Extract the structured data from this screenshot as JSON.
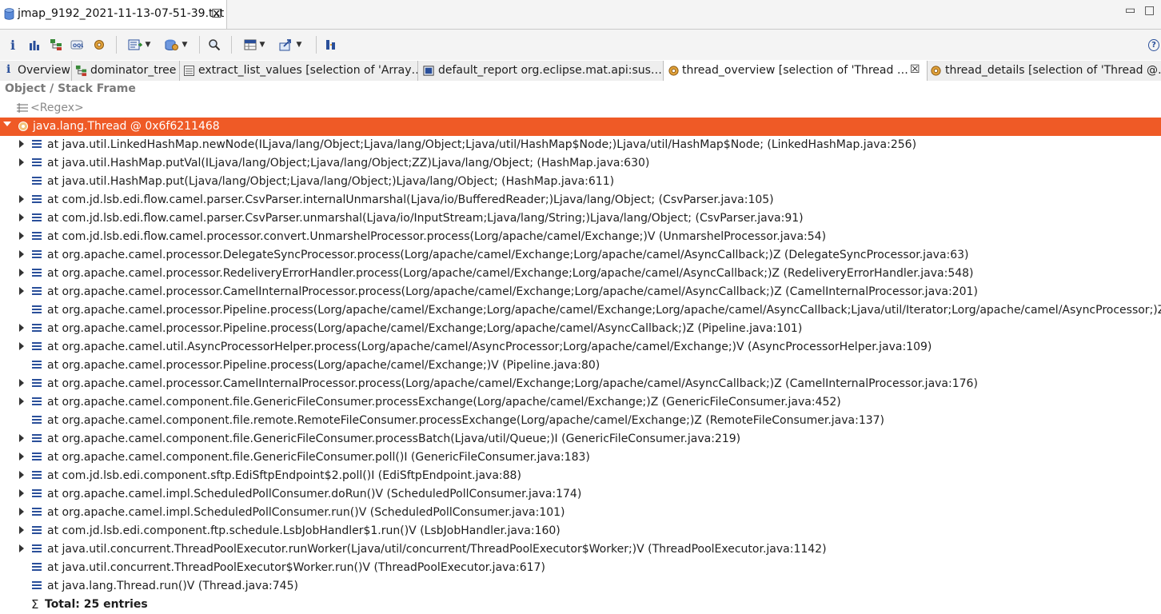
{
  "editor_tab": {
    "title": "jmap_9192_2021-11-13-07-51-39.txt",
    "close": "☒"
  },
  "window": {
    "minimize": "▭",
    "maximize": "□"
  },
  "toolbar": {
    "info": "i",
    "help": "?"
  },
  "query_tabs": [
    {
      "label": "Overview",
      "icon": "info-icon"
    },
    {
      "label": "dominator_tree",
      "icon": "tree-icon"
    },
    {
      "label": "extract_list_values  [selection of 'Array…",
      "icon": "table-icon"
    },
    {
      "label": "default_report  org.eclipse.mat.api:sus…",
      "icon": "report-icon"
    },
    {
      "label": "thread_overview  [selection of 'Thread …",
      "icon": "gear-icon",
      "active": true
    },
    {
      "label": "thread_details  [selection of 'Thread @…",
      "icon": "gear-icon"
    }
  ],
  "column_header": "Object / Stack Frame",
  "regex_placeholder": "<Regex>",
  "thread_row": "java.lang.Thread @ 0x6f6211468",
  "frames": [
    {
      "text": "at java.util.LinkedHashMap.newNode(ILjava/lang/Object;Ljava/lang/Object;Ljava/util/HashMap$Node;)Ljava/util/HashMap$Node; (LinkedHashMap.java:256)",
      "expandable": true
    },
    {
      "text": "at java.util.HashMap.putVal(ILjava/lang/Object;Ljava/lang/Object;ZZ)Ljava/lang/Object; (HashMap.java:630)",
      "expandable": true
    },
    {
      "text": "at java.util.HashMap.put(Ljava/lang/Object;Ljava/lang/Object;)Ljava/lang/Object; (HashMap.java:611)",
      "expandable": false
    },
    {
      "text": "at com.jd.lsb.edi.flow.camel.parser.CsvParser.internalUnmarshal(Ljava/io/BufferedReader;)Ljava/lang/Object; (CsvParser.java:105)",
      "expandable": true
    },
    {
      "text": "at com.jd.lsb.edi.flow.camel.parser.CsvParser.unmarshal(Ljava/io/InputStream;Ljava/lang/String;)Ljava/lang/Object; (CsvParser.java:91)",
      "expandable": true
    },
    {
      "text": "at com.jd.lsb.edi.flow.camel.processor.convert.UnmarshelProcessor.process(Lorg/apache/camel/Exchange;)V (UnmarshelProcessor.java:54)",
      "expandable": true
    },
    {
      "text": "at org.apache.camel.processor.DelegateSyncProcessor.process(Lorg/apache/camel/Exchange;Lorg/apache/camel/AsyncCallback;)Z (DelegateSyncProcessor.java:63)",
      "expandable": true
    },
    {
      "text": "at org.apache.camel.processor.RedeliveryErrorHandler.process(Lorg/apache/camel/Exchange;Lorg/apache/camel/AsyncCallback;)Z (RedeliveryErrorHandler.java:548)",
      "expandable": true
    },
    {
      "text": "at org.apache.camel.processor.CamelInternalProcessor.process(Lorg/apache/camel/Exchange;Lorg/apache/camel/AsyncCallback;)Z (CamelInternalProcessor.java:201)",
      "expandable": true
    },
    {
      "text": "at org.apache.camel.processor.Pipeline.process(Lorg/apache/camel/Exchange;Lorg/apache/camel/Exchange;Lorg/apache/camel/AsyncCallback;Ljava/util/Iterator;Lorg/apache/camel/AsyncProcessor;)Z (Pipel",
      "expandable": false
    },
    {
      "text": "at org.apache.camel.processor.Pipeline.process(Lorg/apache/camel/Exchange;Lorg/apache/camel/AsyncCallback;)Z (Pipeline.java:101)",
      "expandable": true
    },
    {
      "text": "at org.apache.camel.util.AsyncProcessorHelper.process(Lorg/apache/camel/AsyncProcessor;Lorg/apache/camel/Exchange;)V (AsyncProcessorHelper.java:109)",
      "expandable": true
    },
    {
      "text": "at org.apache.camel.processor.Pipeline.process(Lorg/apache/camel/Exchange;)V (Pipeline.java:80)",
      "expandable": false
    },
    {
      "text": "at org.apache.camel.processor.CamelInternalProcessor.process(Lorg/apache/camel/Exchange;Lorg/apache/camel/AsyncCallback;)Z (CamelInternalProcessor.java:176)",
      "expandable": true
    },
    {
      "text": "at org.apache.camel.component.file.GenericFileConsumer.processExchange(Lorg/apache/camel/Exchange;)Z (GenericFileConsumer.java:452)",
      "expandable": true
    },
    {
      "text": "at org.apache.camel.component.file.remote.RemoteFileConsumer.processExchange(Lorg/apache/camel/Exchange;)Z (RemoteFileConsumer.java:137)",
      "expandable": false
    },
    {
      "text": "at org.apache.camel.component.file.GenericFileConsumer.processBatch(Ljava/util/Queue;)I (GenericFileConsumer.java:219)",
      "expandable": true
    },
    {
      "text": "at org.apache.camel.component.file.GenericFileConsumer.poll()I (GenericFileConsumer.java:183)",
      "expandable": true
    },
    {
      "text": "at com.jd.lsb.edi.component.sftp.EdiSftpEndpoint$2.poll()I (EdiSftpEndpoint.java:88)",
      "expandable": true
    },
    {
      "text": "at org.apache.camel.impl.ScheduledPollConsumer.doRun()V (ScheduledPollConsumer.java:174)",
      "expandable": true
    },
    {
      "text": "at org.apache.camel.impl.ScheduledPollConsumer.run()V (ScheduledPollConsumer.java:101)",
      "expandable": true
    },
    {
      "text": "at com.jd.lsb.edi.component.ftp.schedule.LsbJobHandler$1.run()V (LsbJobHandler.java:160)",
      "expandable": true
    },
    {
      "text": "at java.util.concurrent.ThreadPoolExecutor.runWorker(Ljava/util/concurrent/ThreadPoolExecutor$Worker;)V (ThreadPoolExecutor.java:1142)",
      "expandable": true
    },
    {
      "text": "at java.util.concurrent.ThreadPoolExecutor$Worker.run()V (ThreadPoolExecutor.java:617)",
      "expandable": false
    },
    {
      "text": "at java.lang.Thread.run()V (Thread.java:745)",
      "expandable": false
    }
  ],
  "total": {
    "sigma": "Σ",
    "label": "Total: 25 entries"
  },
  "colors": {
    "selection": "#ef5a26",
    "stack_icon": "#2a4f9a"
  }
}
